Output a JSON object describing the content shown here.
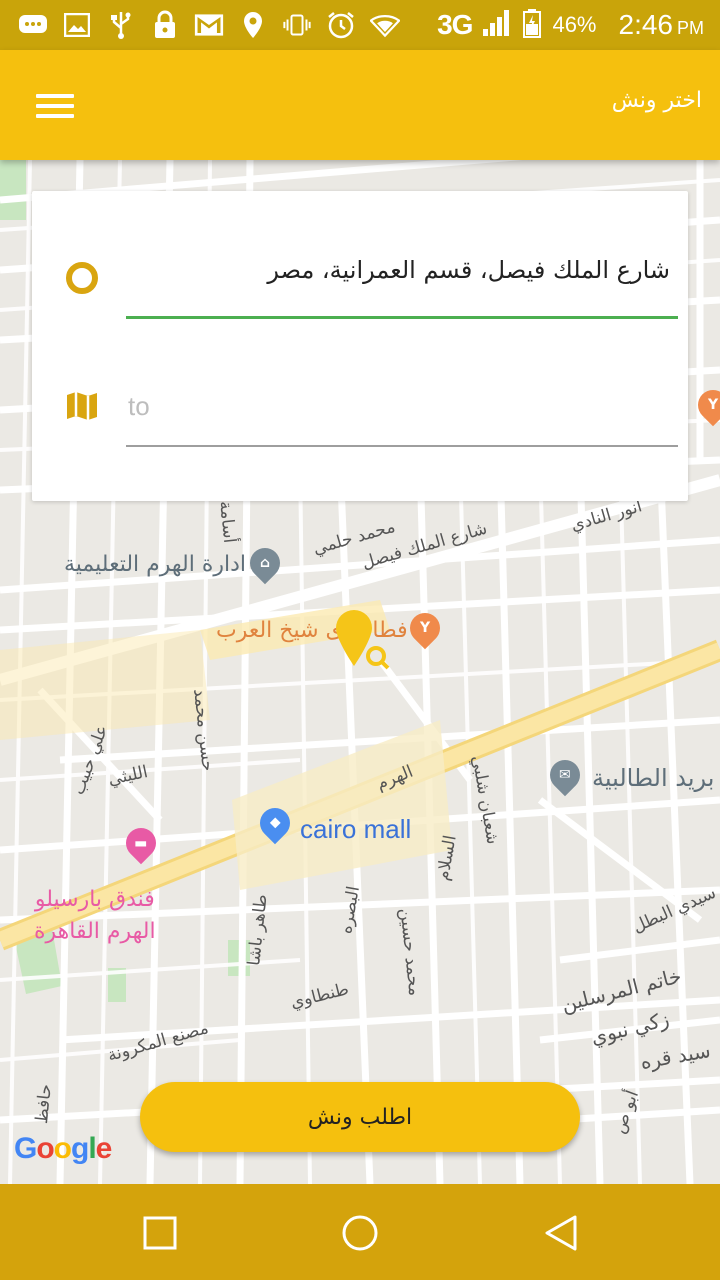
{
  "status_bar": {
    "network": "3G",
    "battery": "46%",
    "time": "2:46",
    "ampm": "PM",
    "icons": [
      "chat-icon",
      "image-icon",
      "usb-icon",
      "lock-icon",
      "gmail-icon",
      "location-icon",
      "vibrate-icon",
      "alarm-icon",
      "wifi-icon",
      "signal-icon",
      "battery-icon"
    ]
  },
  "app_bar": {
    "title": "اختر ونش",
    "menu_icon": "hamburger-menu-icon"
  },
  "route_card": {
    "origin_value": "شارع الملك فيصل، قسم العمرانية، مصر",
    "destination_placeholder": "to",
    "origin_icon": "origin-circle-icon",
    "destination_icon": "map-icon",
    "colors": {
      "origin_underline": "#4caf50",
      "marker": "#d9a510"
    }
  },
  "map": {
    "labels": {
      "education_admin": "ادارة الهرم التعليمية",
      "restaurant": "فطاطرى شيخ العرب",
      "mall": "cairo mall",
      "post_office": "بريد الطالبية",
      "hotel_line1": "فندق بارسيلو",
      "hotel_line2": "الهرم القاهرة",
      "street_faisal": "شارع الملك فيصل",
      "street_haram": "الهرم",
      "street_mohamed_helmy": "محمد حلمي",
      "street_anwar": "أنور النادي",
      "street_khatem": "خاتم المرسلين",
      "street_zaki": "زكي نبوي",
      "street_sayed": "سيد قره",
      "street_tantawy": "طنطاوي",
      "street_factory": "مصنع المكرونة",
      "street_sidi": "سيدي البطل",
      "street_laithy": "الليثي",
      "street_salam": "السلام",
      "street_basra": "البصره",
      "street_hassan": "حسن محمد",
      "street_taher": "طاهر باشا",
      "street_mohamed_hussein": "محمد حسين",
      "street_shaaban": "شعبان شلبي",
      "street_osama": "أسامة",
      "street_ali_habib": "علي حبيب",
      "street_abu": "أبو ص",
      "street_hafez": "حافظ"
    },
    "attribution": "Google",
    "colors": {
      "main_road": "#fbe39a",
      "park": "#c8e6c0",
      "selected_pin": "#f5c518"
    }
  },
  "actions": {
    "request_label": "اطلب ونش"
  },
  "nav_bar": {
    "icons": [
      "recents-square-icon",
      "home-circle-icon",
      "back-triangle-icon"
    ]
  }
}
